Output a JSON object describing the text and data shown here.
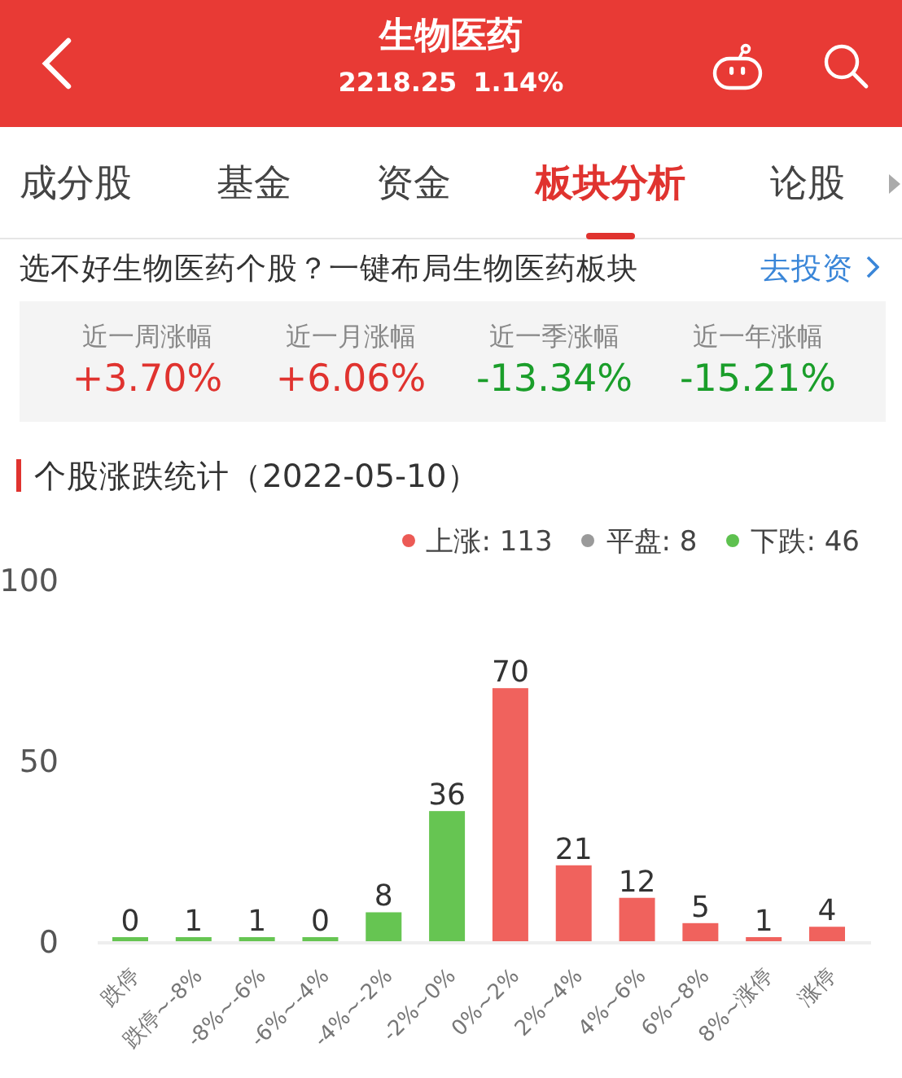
{
  "header": {
    "title": "生物医药",
    "price": "2218.25",
    "change": "1.14%"
  },
  "tabs": [
    {
      "label": "成分股",
      "selected": false
    },
    {
      "label": "基金",
      "selected": false
    },
    {
      "label": "资金",
      "selected": false
    },
    {
      "label": "板块分析",
      "selected": true
    },
    {
      "label": "论股",
      "selected": false
    }
  ],
  "promo": {
    "text": "选不好生物医药个股？一键布局生物医药板块",
    "link": "去投资"
  },
  "stats": [
    {
      "label": "近一周涨幅",
      "value": "+3.70%",
      "kind": "up"
    },
    {
      "label": "近一月涨幅",
      "value": "+6.06%",
      "kind": "up"
    },
    {
      "label": "近一季涨幅",
      "value": "-13.34%",
      "kind": "down"
    },
    {
      "label": "近一年涨幅",
      "value": "-15.21%",
      "kind": "down"
    }
  ],
  "section": {
    "title": "个股涨跌统计（2022-05-10）",
    "legend": [
      {
        "label": "上涨: 113",
        "color": "#ec5a55"
      },
      {
        "label": "平盘: 8",
        "color": "#9a9a9a"
      },
      {
        "label": "下跌: 46",
        "color": "#5ec14f"
      }
    ],
    "chart_data": {
      "type": "bar",
      "stacked": true,
      "data_labels": true,
      "ylim": [
        0,
        100
      ],
      "yticks": [
        0,
        50,
        100
      ],
      "categories": [
        "跌停",
        "跌停~-8%",
        "-8%~-6%",
        "-6%~-4%",
        "-4%~-2%",
        "-2%~0%",
        "0%~2%",
        "2%~4%",
        "4%~6%",
        "6%~8%",
        "8%~涨停",
        "涨停"
      ],
      "series": [
        {
          "color": "#66c552",
          "values": [
            0,
            1,
            1,
            0,
            8,
            36,
            null,
            null,
            null,
            null,
            null,
            null
          ]
        },
        {
          "color": "#f0625d",
          "values": [
            null,
            null,
            null,
            null,
            null,
            null,
            70,
            21,
            12,
            5,
            1,
            4
          ]
        }
      ]
    }
  }
}
